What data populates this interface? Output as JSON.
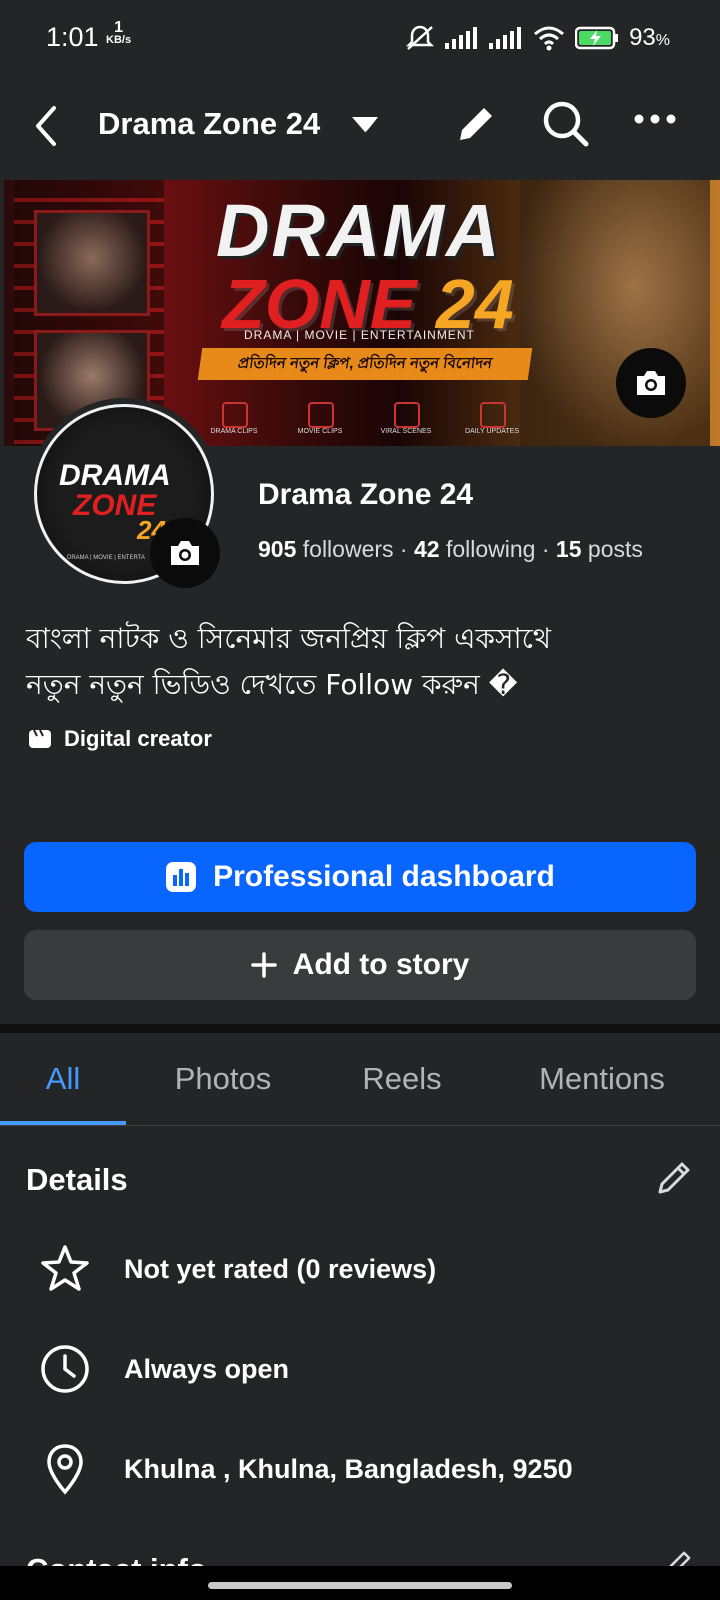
{
  "status_bar": {
    "time": "1:01",
    "net_speed_value": "1",
    "net_speed_unit": "KB/s",
    "battery_percent": "93",
    "battery_unit": "%"
  },
  "header": {
    "page_name": "Drama Zone 24"
  },
  "cover": {
    "title_line1": "DRAMA",
    "title_line2": "ZONE",
    "title_number": "24",
    "tagline": "DRAMA | MOVIE | ENTERTAINMENT",
    "banner_text": "প্রতিদিন নতুন ক্লিপ, প্রতিদিন নতুন বিনোদন",
    "categories": [
      "DRAMA CLIPS",
      "MOVIE CLIPS",
      "VIRAL SCENES",
      "DAILY UPDATES"
    ]
  },
  "avatar": {
    "line1": "DRAMA",
    "line2": "ZONE",
    "line3": "24",
    "subtitle": "DRAMA | MOVIE | ENTERTA"
  },
  "profile": {
    "name": "Drama Zone 24",
    "followers_count": "905",
    "followers_label": "followers",
    "following_count": "42",
    "following_label": "following",
    "posts_count": "15",
    "posts_label": "posts",
    "separator": "·",
    "bio_line1": "বাংলা নাটক ও সিনেমার জনপ্রিয় ক্লিপ একসাথে",
    "bio_line2": "নতুন নতুন ভিডিও দেখতে Follow করুন �",
    "category": "Digital creator"
  },
  "buttons": {
    "professional_dashboard": "Professional dashboard",
    "add_to_story": "Add to story"
  },
  "tabs": [
    {
      "label": "All",
      "active": true
    },
    {
      "label": "Photos",
      "active": false
    },
    {
      "label": "Reels",
      "active": false
    },
    {
      "label": "Mentions",
      "active": false
    }
  ],
  "details": {
    "title": "Details",
    "rows": [
      {
        "icon": "star-icon",
        "text": "Not yet rated (0 reviews)"
      },
      {
        "icon": "clock-icon",
        "text": "Always open"
      },
      {
        "icon": "location-pin-icon",
        "text": "Khulna , Khulna, Bangladesh, 9250"
      }
    ]
  },
  "contact": {
    "title": "Contact info"
  },
  "colors": {
    "background": "#242526",
    "primary_button": "#0866ff",
    "secondary_button": "#3a3b3c",
    "active_tab": "#4599ff",
    "text": "#e4e6eb"
  }
}
